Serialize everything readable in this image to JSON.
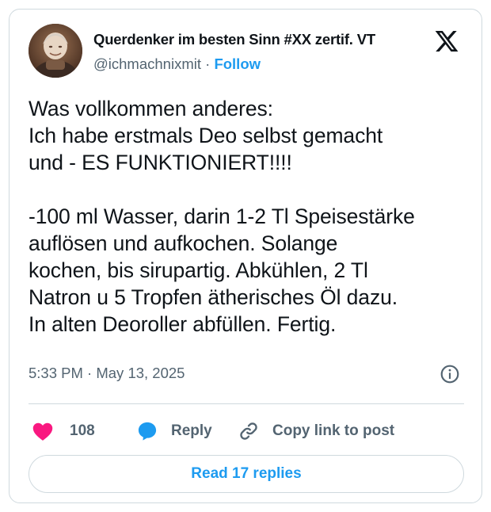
{
  "author": {
    "display_name": "Querdenker im besten Sinn #XX zertif. VT",
    "handle": "@ichmachnixmit",
    "separator": "·",
    "follow_label": "Follow"
  },
  "post": {
    "text": "Was vollkommen anderes:\nIch habe erstmals Deo selbst gemacht\nund - ES FUNKTIONIERT!!!!\n\n-100 ml Wasser, darin 1-2 Tl Speisestärke\nauflösen und aufkochen. Solange\nkochen, bis sirupartig. Abkühlen, 2 Tl\nNatron u 5 Tropfen ätherisches Öl dazu.\nIn alten Deoroller abfüllen. Fertig.",
    "time": "5:33 PM",
    "date_separator": "·",
    "date": "May 13, 2025"
  },
  "actions": {
    "like_count": "108",
    "reply_label": "Reply",
    "copy_label": "Copy link to post"
  },
  "read_replies_label": "Read 17 replies",
  "icons": {
    "platform_logo": "x-logo-icon",
    "info": "info-icon",
    "like": "heart-icon",
    "reply": "speech-bubble-icon",
    "copy": "link-icon"
  },
  "colors": {
    "accent": "#1d9bf0",
    "like": "#f91880",
    "secondary_text": "#536471",
    "border": "#cfd9de"
  }
}
